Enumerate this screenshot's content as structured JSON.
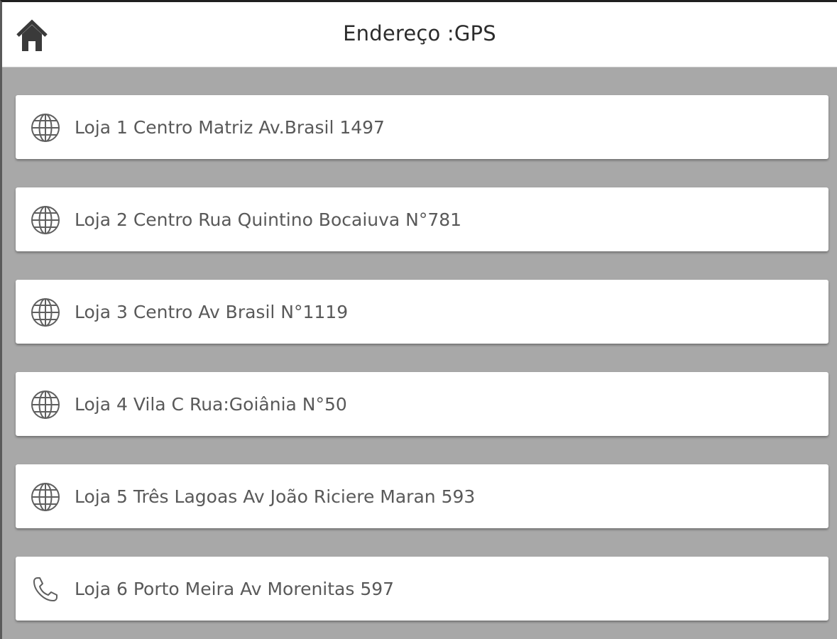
{
  "header": {
    "title": "Endereço :GPS",
    "home_icon": "home-icon"
  },
  "stores": [
    {
      "label": "Loja 1 Centro Matriz Av.Brasil 1497",
      "icon": "globe-icon"
    },
    {
      "label": "Loja 2 Centro Rua Quintino Bocaiuva N°781",
      "icon": "globe-icon"
    },
    {
      "label": "Loja 3 Centro Av Brasil N°1119",
      "icon": "globe-icon"
    },
    {
      "label": "Loja 4 Vila C Rua:Goiânia N°50",
      "icon": "globe-icon"
    },
    {
      "label": "Loja 5 Três Lagoas Av João Riciere Maran 593",
      "icon": "globe-icon"
    },
    {
      "label": "Loja 6 Porto Meira Av Morenitas 597",
      "icon": "phone-icon"
    }
  ],
  "colors": {
    "background": "#a8a8a8",
    "card": "#ffffff",
    "text": "#595959",
    "title": "#2c2c2c",
    "icon": "#5f5f5f"
  }
}
